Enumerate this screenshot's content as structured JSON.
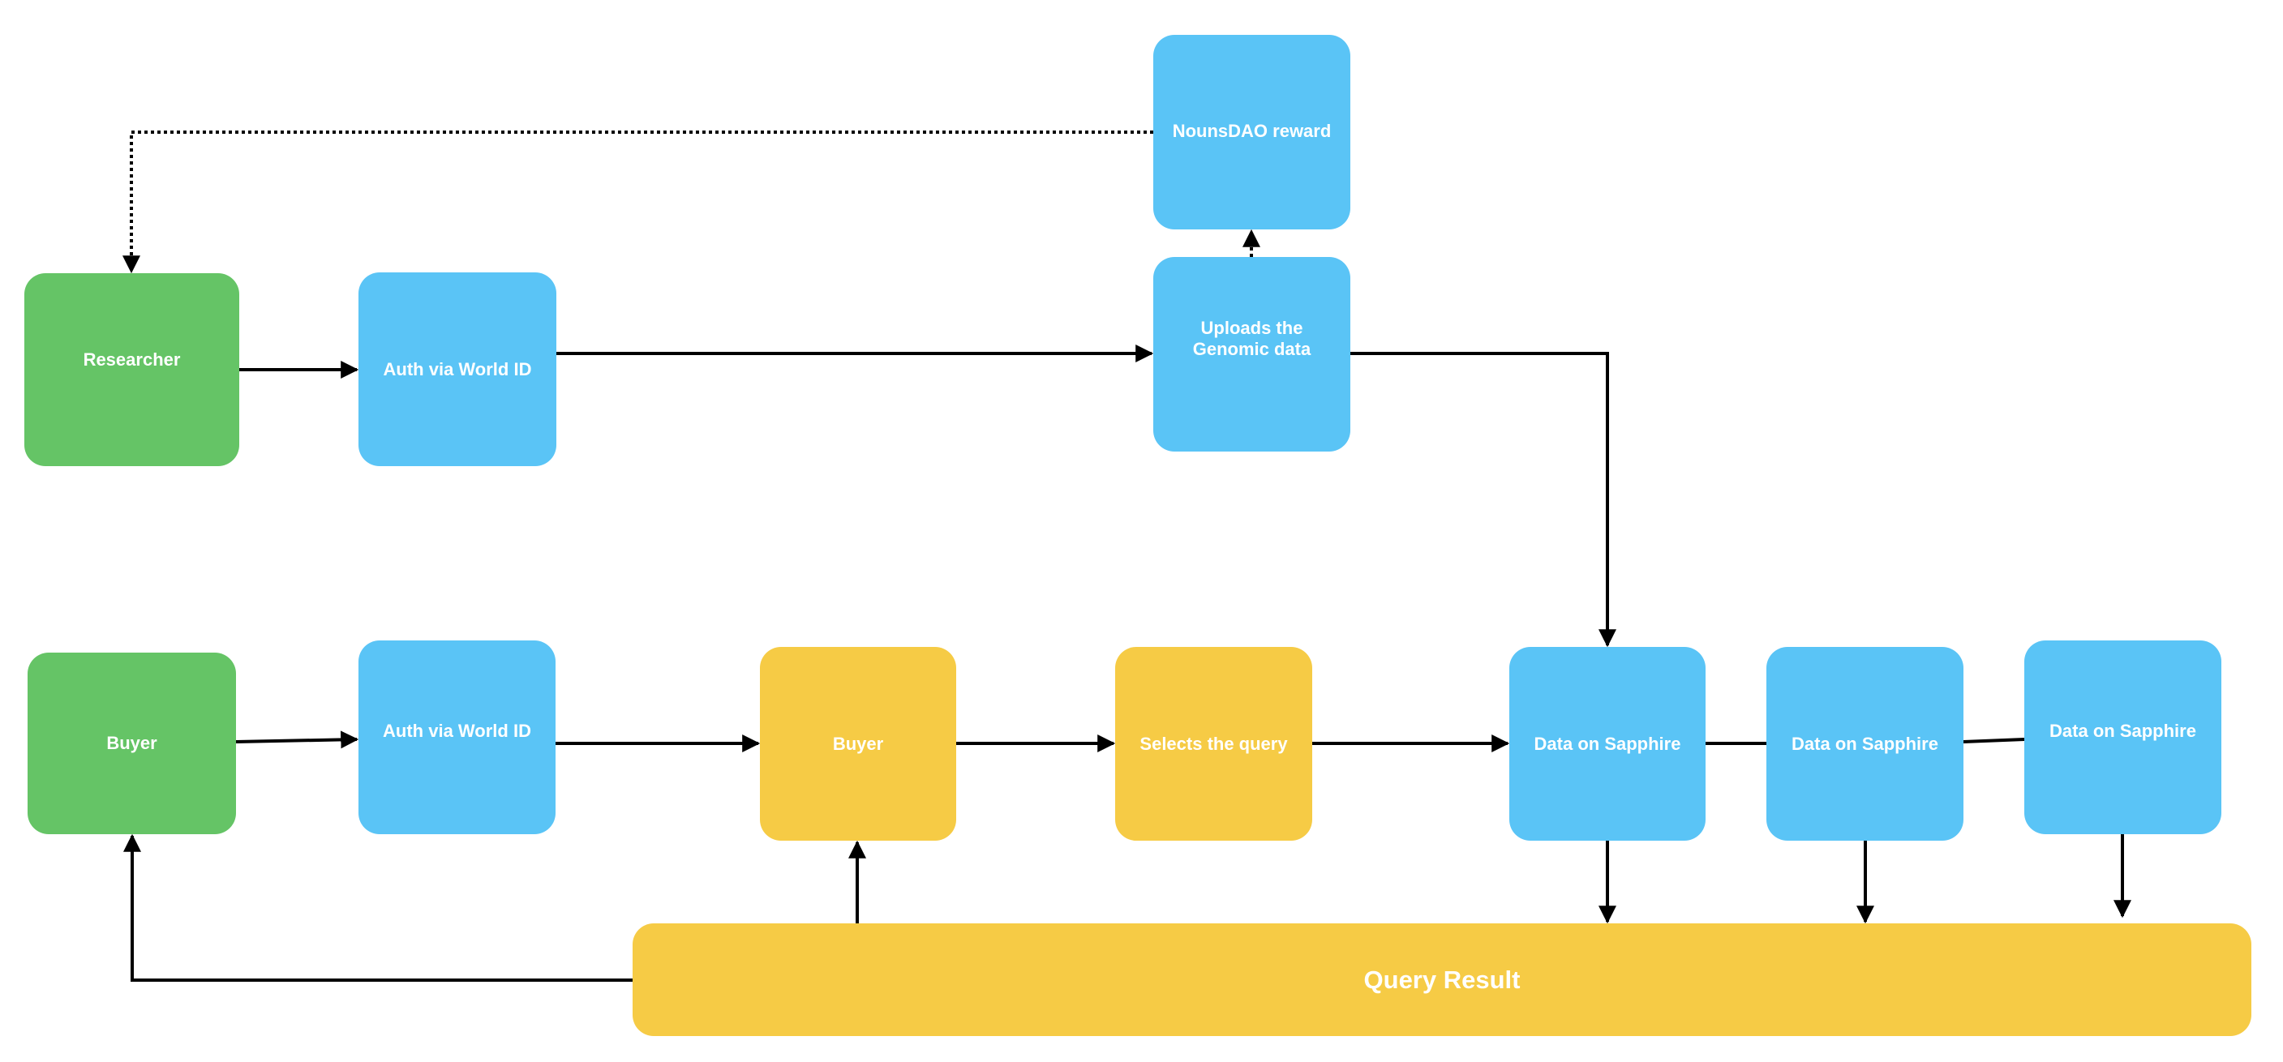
{
  "diagram": {
    "type": "flowchart",
    "colors": {
      "actor": "#65C466",
      "process": "#5AC4F6",
      "query": "#F6CB45",
      "edge": "#000000",
      "background": "#FFFFFF",
      "label": "#FFFFFF"
    },
    "nodes": {
      "researcher": {
        "label": "Researcher",
        "kind": "actor"
      },
      "auth_researcher": {
        "label": "Auth via World ID",
        "kind": "process"
      },
      "uploads": {
        "label": "Uploads the\nGenomic data",
        "kind": "process"
      },
      "nouns_reward": {
        "label": "NounsDAO reward",
        "kind": "process"
      },
      "buyer_actor": {
        "label": "Buyer",
        "kind": "actor"
      },
      "auth_buyer": {
        "label": "Auth via World ID",
        "kind": "process"
      },
      "buyer_step": {
        "label": "Buyer",
        "kind": "query"
      },
      "selects_query": {
        "label": "Selects the query",
        "kind": "query"
      },
      "sapphire_1": {
        "label": "Data on Sapphire",
        "kind": "process"
      },
      "sapphire_2": {
        "label": "Data on Sapphire",
        "kind": "process"
      },
      "sapphire_3": {
        "label": "Data on Sapphire",
        "kind": "process"
      },
      "query_result": {
        "label": "Query Result",
        "kind": "query"
      }
    },
    "edges": [
      {
        "from": "researcher",
        "to": "auth_researcher",
        "style": "solid",
        "arrow": true
      },
      {
        "from": "auth_researcher",
        "to": "uploads",
        "style": "solid",
        "arrow": true
      },
      {
        "from": "uploads",
        "to": "nouns_reward",
        "style": "dotted",
        "arrow": true
      },
      {
        "from": "nouns_reward",
        "to": "researcher",
        "style": "dotted",
        "arrow": true
      },
      {
        "from": "uploads",
        "to": "sapphire_1",
        "style": "solid",
        "arrow": true
      },
      {
        "from": "buyer_actor",
        "to": "auth_buyer",
        "style": "solid",
        "arrow": true
      },
      {
        "from": "auth_buyer",
        "to": "buyer_step",
        "style": "solid",
        "arrow": true
      },
      {
        "from": "buyer_step",
        "to": "selects_query",
        "style": "solid",
        "arrow": true
      },
      {
        "from": "selects_query",
        "to": "sapphire_1",
        "style": "solid",
        "arrow": true
      },
      {
        "from": "sapphire_1",
        "to": "sapphire_2",
        "style": "solid",
        "arrow": false
      },
      {
        "from": "sapphire_2",
        "to": "sapphire_3",
        "style": "solid",
        "arrow": false
      },
      {
        "from": "sapphire_1",
        "to": "query_result",
        "style": "solid",
        "arrow": true
      },
      {
        "from": "sapphire_2",
        "to": "query_result",
        "style": "solid",
        "arrow": true
      },
      {
        "from": "sapphire_3",
        "to": "query_result",
        "style": "solid",
        "arrow": true
      },
      {
        "from": "query_result",
        "to": "buyer_step",
        "style": "solid",
        "arrow": true
      },
      {
        "from": "query_result",
        "to": "buyer_actor",
        "style": "solid",
        "arrow": true
      }
    ]
  }
}
